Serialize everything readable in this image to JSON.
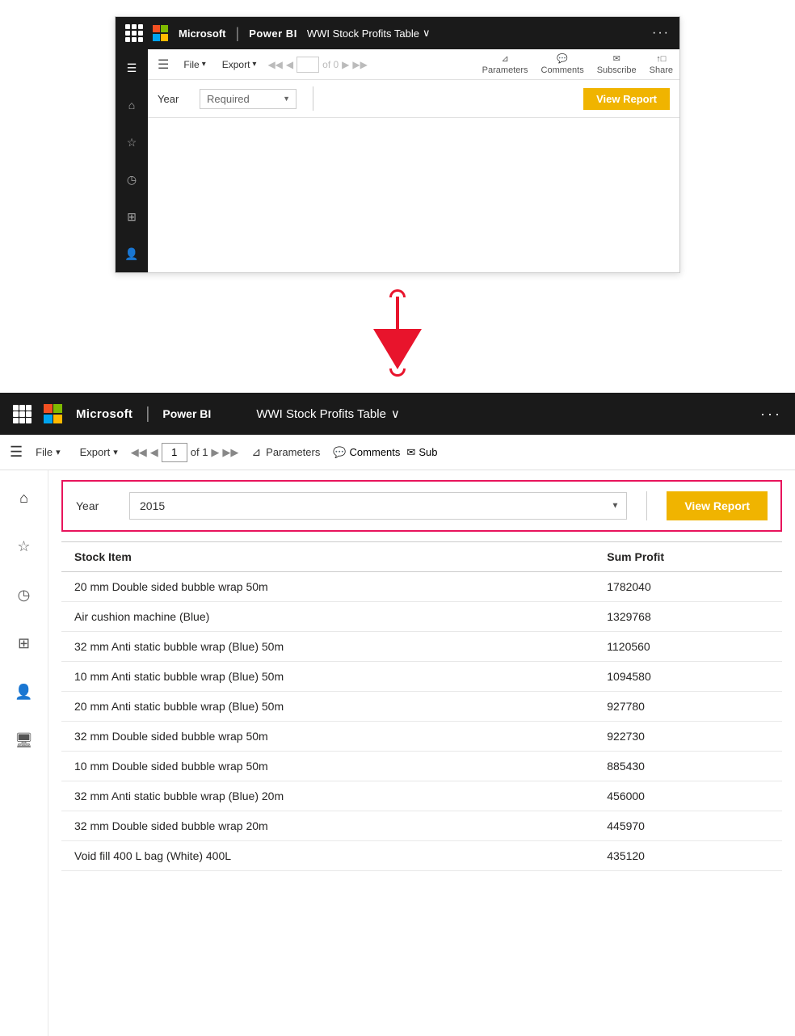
{
  "top_browser": {
    "nav": {
      "grid_icon_label": "apps",
      "microsoft_label": "Microsoft",
      "divider": "|",
      "brand": "Power BI",
      "report_name": "WWI Stock Profits Table",
      "chevron": "∨",
      "more": "···"
    },
    "toolbar": {
      "hamburger": "☰",
      "file_label": "File",
      "file_arrow": "▾",
      "export_label": "Export",
      "export_arrow": "▾",
      "nav_prev_prev": "◀◀",
      "nav_prev": "◀",
      "page_current": "",
      "of_text": "of 0",
      "nav_next": "▶",
      "nav_next_next": "▶▶",
      "parameters_label": "Parameters",
      "comments_label": "Comments",
      "subscribe_label": "Subscribe",
      "share_label": "Share"
    },
    "params": {
      "year_label": "Year",
      "year_placeholder": "Required",
      "view_report_label": "View Report"
    },
    "sidebar": {
      "home_icon": "⌂",
      "star_icon": "☆",
      "clock_icon": "◷",
      "apps_icon": "⊞",
      "people_icon": "👤"
    }
  },
  "arrow": {
    "direction": "down"
  },
  "bottom_browser": {
    "nav": {
      "grid_icon_label": "apps",
      "microsoft_label": "Microsoft",
      "divider": "|",
      "brand": "Power BI",
      "report_name": "WWI Stock Profits Table",
      "chevron": "∨",
      "more": "···"
    },
    "toolbar": {
      "hamburger": "☰",
      "file_label": "File",
      "file_arrow": "▾",
      "export_label": "Export",
      "export_arrow": "▾",
      "nav_prev_prev": "◀◀",
      "nav_prev": "◀",
      "page_current": "1",
      "of_text": "of 1",
      "nav_next": "▶",
      "nav_next_next": "▶▶",
      "parameters_label": "Parameters",
      "comments_label": "Comments",
      "subscribe_label": "Sub"
    },
    "params": {
      "year_label": "Year",
      "year_value": "2015",
      "view_report_label": "View Report"
    },
    "sidebar": {
      "home_icon": "⌂",
      "star_icon": "☆",
      "clock_icon": "◷",
      "apps_icon": "⊞",
      "people_icon": "👤",
      "screen_icon": "🖥"
    },
    "table": {
      "col1_header": "Stock Item",
      "col2_header": "Sum Profit",
      "rows": [
        {
          "item": "20 mm Double sided bubble wrap 50m",
          "profit": "1782040"
        },
        {
          "item": "Air cushion machine (Blue)",
          "profit": "1329768"
        },
        {
          "item": "32 mm Anti static bubble wrap (Blue) 50m",
          "profit": "1120560"
        },
        {
          "item": "10 mm Anti static bubble wrap (Blue) 50m",
          "profit": "1094580"
        },
        {
          "item": "20 mm Anti static bubble wrap (Blue) 50m",
          "profit": "927780"
        },
        {
          "item": "32 mm Double sided bubble wrap 50m",
          "profit": "922730"
        },
        {
          "item": "10 mm Double sided bubble wrap 50m",
          "profit": "885430"
        },
        {
          "item": "32 mm Anti static bubble wrap (Blue) 20m",
          "profit": "456000"
        },
        {
          "item": "32 mm Double sided bubble wrap 20m",
          "profit": "445970"
        },
        {
          "item": "Void fill 400 L bag (White) 400L",
          "profit": "435120"
        }
      ]
    }
  }
}
